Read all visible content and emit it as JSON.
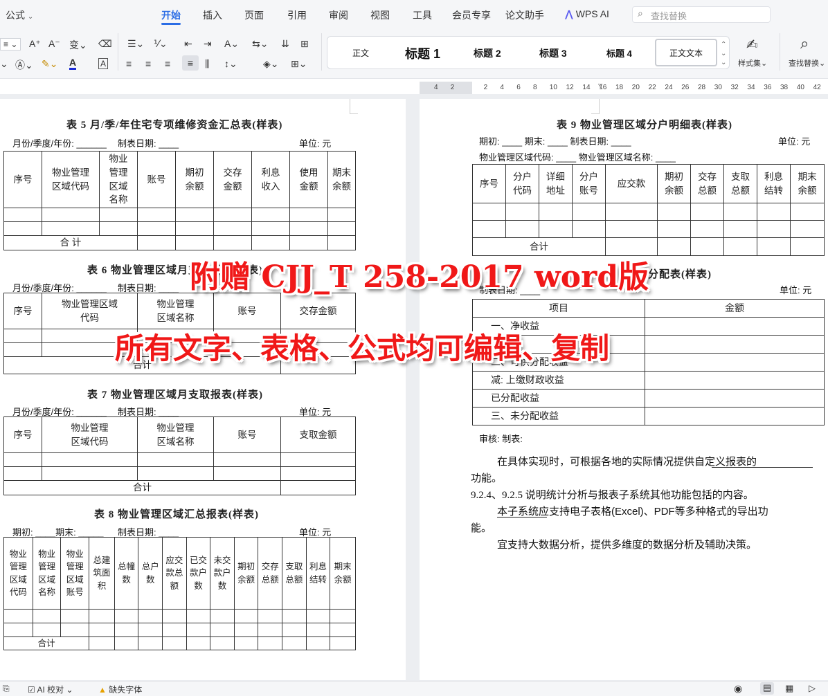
{
  "menu": {
    "formula": "公式",
    "tabs": [
      "开始",
      "插入",
      "页面",
      "引用",
      "审阅",
      "视图",
      "工具",
      "会员专享",
      "论文助手"
    ],
    "wps_ai": "WPS AI",
    "search_placeholder": "查找替换"
  },
  "ribbon": {
    "styles": [
      "正文",
      "标题 1",
      "标题 2",
      "标题 3",
      "标题 4",
      "正文文本"
    ],
    "style_set": "样式集",
    "find_replace": "查找替换"
  },
  "ruler": [
    "4",
    "2",
    "2",
    "4",
    "6",
    "8",
    "10",
    "12",
    "14",
    "16",
    "18",
    "20",
    "22",
    "24",
    "26",
    "28",
    "30",
    "32",
    "34",
    "36",
    "38",
    "40",
    "42"
  ],
  "left": {
    "t5": {
      "title": "表 5  月/季/年住宅专项维修资金汇总表(样表)",
      "meta_left": "月份/季度/年份: ______",
      "meta_mid": "制表日期: ____",
      "meta_right": "单位: 元",
      "headers": [
        "序号",
        "物业管理\n区域代码",
        "物业\n管理\n区域\n名称",
        "账号",
        "期初\n余额",
        "交存\n金额",
        "利息\n收入",
        "使用\n金额",
        "期末\n余额"
      ],
      "total": "合 计"
    },
    "t6": {
      "title": "表 6  物业管理区域月支取报表(样表)",
      "meta_left": "月份/季度/年份: ______",
      "meta_mid": "制表日期: ____",
      "headers": [
        "序号",
        "物业管理区域\n代码",
        "物业管理\n区域名称",
        "账号",
        "交存金额"
      ],
      "total": "合计"
    },
    "t7": {
      "title": "表 7  物业管理区域月支取报表(样表)",
      "meta_left": "月份/季度/年份: ______",
      "meta_mid": "制表日期: ____",
      "meta_right": "单位: 元",
      "headers": [
        "序号",
        "物业管理\n区域代码",
        "物业管理\n区域名称",
        "账号",
        "支取金额"
      ],
      "total": "合计"
    },
    "t8": {
      "title": "表 8  物业管理区域汇总报表(样表)",
      "meta_left": "期初: ____期末: _____",
      "meta_mid": "制表日期: ____",
      "meta_right": "单位: 元",
      "headers": [
        "物业\n管理\n区域\n代码",
        "物业\n管理\n区域\n名称",
        "物业\n管理\n区域\n账号",
        "总建\n筑面\n积",
        "总幢\n数",
        "总户\n数",
        "应交\n款总\n额",
        "已交\n款户\n数",
        "未交\n款户\n数",
        "期初\n余额",
        "交存\n总额",
        "支取\n总额",
        "利息\n结转",
        "期末\n余额"
      ],
      "total": "合计"
    }
  },
  "right": {
    "t9": {
      "title": "表 9  物业管理区域分户明细表(样表)",
      "meta1": "期初: ____      期末: ____      制表日期: ____",
      "meta1_right": "单位: 元",
      "meta2": "物业管理区域代码: ____          物业管理区域名称: ____",
      "headers": [
        "序号",
        "分户\n代码",
        "详细\n地址",
        "分户\n账号",
        "应交款",
        "期初\n余额",
        "交存\n总额",
        "支取\n总额",
        "利息\n结转",
        "期末\n余额"
      ],
      "total": "合计"
    },
    "t10": {
      "title": "收益分配表(样表)",
      "meta_left": "制表日期: ____",
      "meta_right": "单位: 元",
      "headers": [
        "项目",
        "金额"
      ],
      "rows": [
        "一、净收益",
        "",
        "二、可供分配收益",
        "减: 上缴财政收益",
        "已分配收益",
        "三、未分配收益"
      ]
    },
    "sign": "审核:                              制表:",
    "p1a": "在具体实现时，可根据各地的实际情况提供自定义报表的",
    "p1b": "功能。",
    "p2": "9.2.4、9.2.5  说明统计分析与报表子系统其他功能包括的内容。",
    "p3a": "本子系统应支持电子表格(Excel)、PDF等多种格式的导出功",
    "p3b": "能。",
    "p4": "宜支持大数据分析，提供多维度的数据分析及辅助决策。"
  },
  "overlay": {
    "line1": "附赠 CJJ_T 258-2017 word版",
    "line2": "所有文字、表格、公式均可编辑、复制"
  },
  "status": {
    "ai_check": "AI 校对",
    "missing_font": "缺失字体"
  }
}
